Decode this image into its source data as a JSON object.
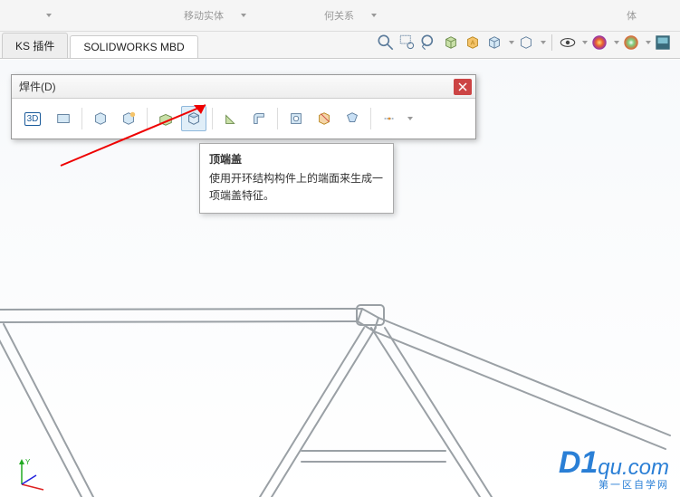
{
  "top": {
    "move_body": "移动实体",
    "geometry_rel": "何关系",
    "body": "体"
  },
  "tabs": {
    "plugin": "KS 插件",
    "mbd": "SOLIDWORKS MBD"
  },
  "toolbar": {
    "title": "焊件(D)",
    "btn_3d": "3D"
  },
  "tooltip": {
    "title": "顶端盖",
    "body": "使用开环结构构件上的端面来生成一项端盖特征。"
  },
  "watermark": {
    "brand": "D1",
    "domain": "qu.com",
    "sub": "第一区自学网"
  }
}
